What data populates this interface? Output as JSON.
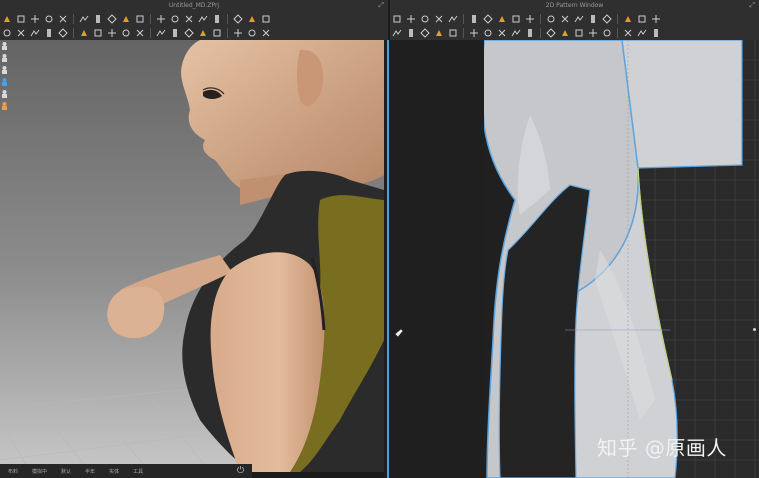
{
  "windows": {
    "left_title": "Untitled_MD.ZPrj",
    "right_title": "2D Pattern Window"
  },
  "toolbar_3d": {
    "row1": [
      "select-move-icon",
      "move-icon",
      "select-mesh-icon",
      "box-select-icon",
      "transform-icon",
      "pin-icon",
      "gather-icon",
      "tack-icon",
      "fold-icon",
      "arrangement-icon",
      "segment-icon",
      "sewing-line-icon",
      "free-sewing-icon",
      "avatar-icon",
      "measure-icon",
      "hanger-icon",
      "shirt-icon",
      "stitch-icon"
    ],
    "row2": [
      "walk-icon",
      "zipper-icon",
      "puckering-icon",
      "button-icon",
      "buttonhole-icon",
      "topstitch-icon",
      "fold-arrange-icon",
      "piping-icon",
      "tape-icon",
      "fit-map-icon",
      "strain-icon",
      "camera-icon",
      "sphere-icon",
      "render-icon",
      "texture-icon",
      "graphic-icon",
      "brush-icon",
      "lock-icon"
    ]
  },
  "toolbar_2d": {
    "row1": [
      "transform-pattern-icon",
      "edit-point-icon",
      "edit-curvature-icon",
      "curve-point-icon",
      "add-point-icon",
      "cut-curve-icon",
      "slash-icon",
      "polygon-icon",
      "rectangle-icon",
      "circle-icon",
      "internal-polygon-icon",
      "internal-rect-icon",
      "internal-circle-icon",
      "dart-icon",
      "trace-icon",
      "seam-allowance-icon",
      "binding-icon",
      "pleat-icon"
    ],
    "row2": [
      "segment-sewing-icon",
      "free-sewing-2d-icon",
      "m-n-sewing-icon",
      "check-sewing-icon",
      "edit-sewing-icon",
      "tape-2d-icon",
      "button-2d-icon",
      "buttonhole-2d-icon",
      "texture-edit-icon",
      "graphic-2d-icon",
      "color-icon",
      "notch-icon",
      "grain-icon",
      "symmetry-icon",
      "fold-line-icon",
      "baseline-icon",
      "measure-2d-icon",
      "ruler-icon"
    ]
  },
  "left_tools": [
    "avatar-front-icon",
    "avatar-side-icon",
    "avatar-back-icon",
    "fabric-icon",
    "hanger-side-icon",
    "head-icon"
  ],
  "status_bar": {
    "items": [
      "布料",
      "模拟中",
      "默认",
      "半年",
      "实体",
      "工具"
    ]
  },
  "watermark": "知乎 @原画人",
  "colors": {
    "selected_piece_fill": "#7d7120",
    "pattern_outline": "#5aa3e0",
    "pattern_fill": "#c7c9cc",
    "divider_accent": "#4a9fe0"
  }
}
